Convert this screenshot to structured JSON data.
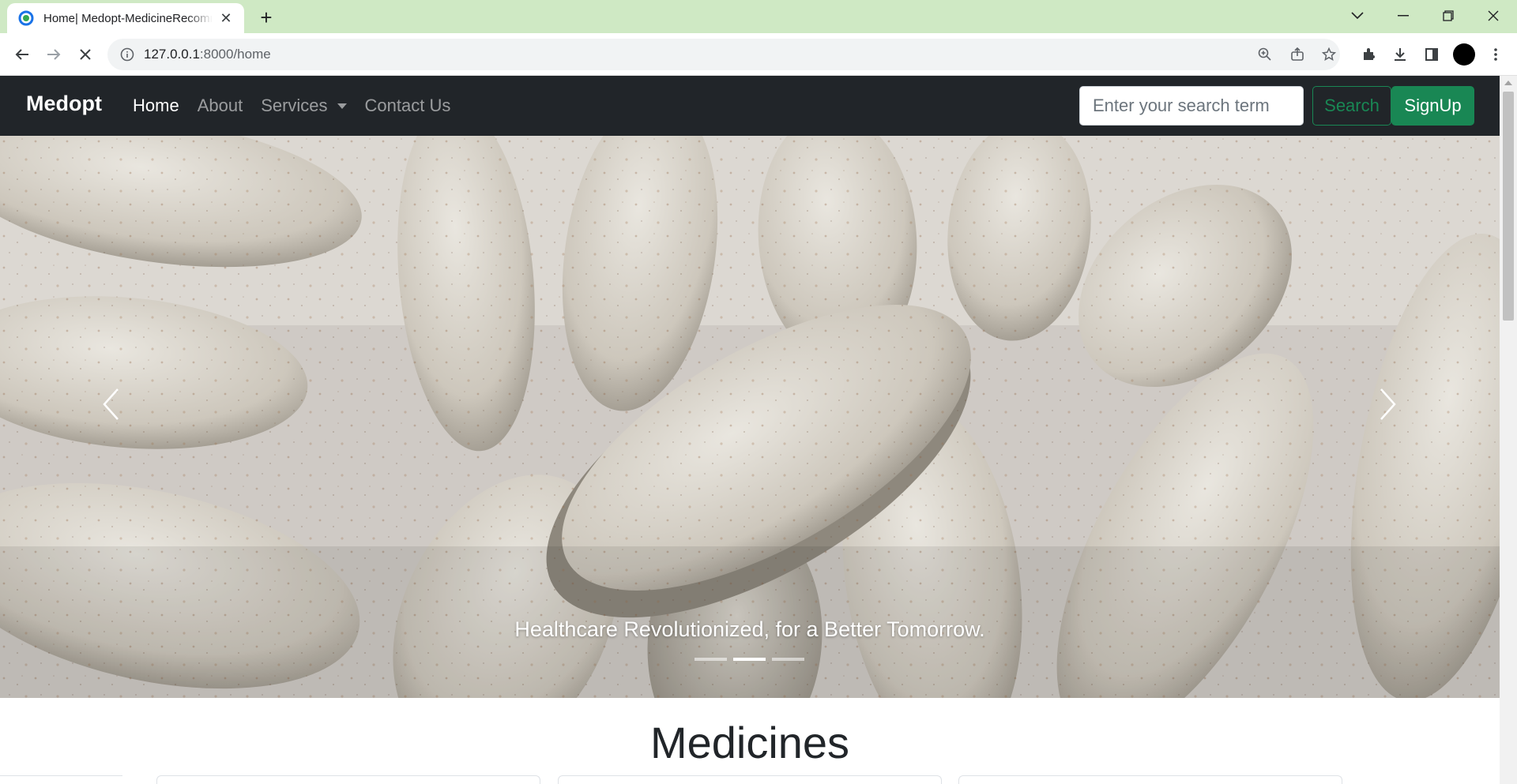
{
  "browser": {
    "tab_title": "Home| Medopt-MedicineRecommender",
    "url_host": "127.0.0.1",
    "url_path": ":8000/home",
    "new_tab": "+"
  },
  "navbar": {
    "brand": "Medopt",
    "links": [
      {
        "label": "Home"
      },
      {
        "label": "About"
      },
      {
        "label": "Services"
      },
      {
        "label": "Contact Us"
      }
    ],
    "search_placeholder": "Enter your search term",
    "search_button": "Search",
    "signup_button": "SignUp"
  },
  "carousel": {
    "caption": "Healthcare Revolutionized, for a Better Tomorrow.",
    "slide_count": 3,
    "active_slide": 2
  },
  "section": {
    "title": "Medicines"
  },
  "colors": {
    "navbar_bg": "#212529",
    "success": "#198754",
    "tabstrip": "#cfe9c4"
  }
}
